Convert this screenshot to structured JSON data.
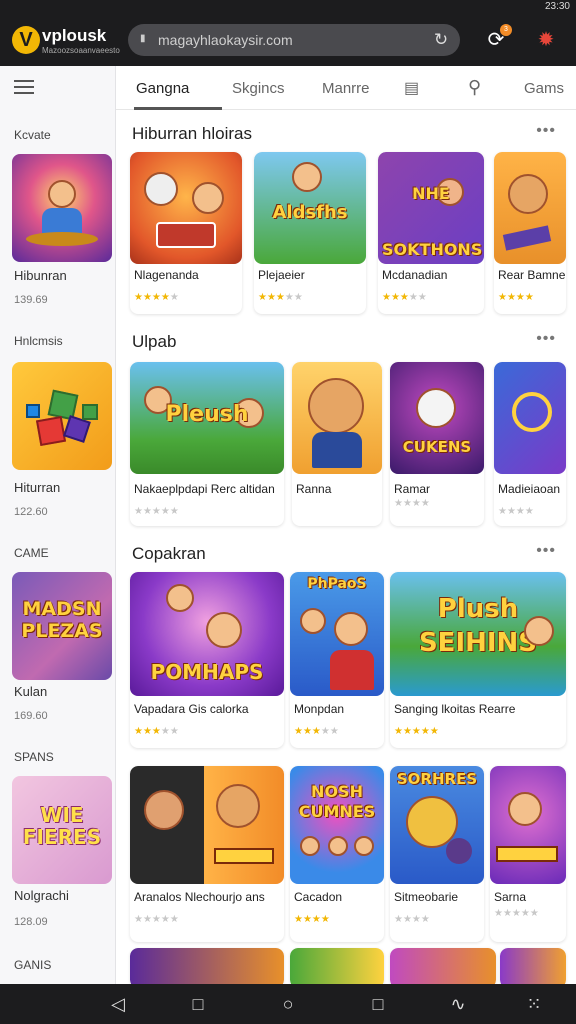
{
  "status": {
    "time": "23:30"
  },
  "header": {
    "logo_name": "vplousk",
    "logo_sub": "Mazoozsoaanvaeesto",
    "url": "magayhlaokaysir.com",
    "icons": [
      "lock-icon",
      "reload-icon",
      "notification-icon",
      "settings-icon"
    ],
    "notification_count": "3"
  },
  "tabs": [
    {
      "label": "Gangna",
      "active": true
    },
    {
      "label": "Skgincs"
    },
    {
      "label": "Manrre"
    },
    {
      "label": ""
    },
    {
      "label": ""
    },
    {
      "label": "Gams"
    }
  ],
  "sidebar": {
    "sections": [
      {
        "header": "Kcvate",
        "title": "Hibunran",
        "meta": "139.69",
        "thumb_word": ""
      },
      {
        "header": "Hnlcmsis",
        "title": "Hiturran",
        "meta": "122.60",
        "thumb_word": ""
      },
      {
        "header": "CAME",
        "title": "Kulan",
        "meta": "169.60",
        "thumb_word": "MADSN PLEZAS"
      },
      {
        "header": "SPANS",
        "title": "Nolgrachi",
        "meta": "128.09",
        "thumb_word": "WIE FIERES"
      },
      {
        "header": "GANIS"
      }
    ]
  },
  "sections": [
    {
      "title": "Hiburran hloiras",
      "cards": [
        {
          "title": "Nlagenanda",
          "rating": 3.5,
          "art_word": ""
        },
        {
          "title": "Plejaeier",
          "rating": 3,
          "art_word": "Aldsfhs"
        },
        {
          "title": "Mcdanadian",
          "rating": 3,
          "art_word": "NHE SOKTHONS"
        },
        {
          "title": "Rear Bamne",
          "rating": 4,
          "art_word": ""
        }
      ]
    },
    {
      "title": "Ulpab",
      "cards": [
        {
          "title": "Nakaeplpdapi Rerc altidan",
          "rating": 0,
          "art_word": "Pleush"
        },
        {
          "title": "Ranna",
          "rating": 0,
          "art_word": ""
        },
        {
          "title": "Ramar",
          "rating": 0,
          "art_word": "CUKENS"
        },
        {
          "title": "Madieiaoan",
          "rating": 0,
          "art_word": ""
        }
      ]
    },
    {
      "title": "Copakran",
      "cards": [
        {
          "title": "Vapadara Gis calorka",
          "rating": 3,
          "art_word": "POMHAPS"
        },
        {
          "title": "Monpdan",
          "rating": 3,
          "art_word": "PhPaoS"
        },
        {
          "title": "Sanging lkoitas Rearre",
          "rating": 5,
          "art_word": "Plush SEIHINS"
        }
      ]
    },
    {
      "title": "",
      "cards": [
        {
          "title": "Aranalos Nlechourjo ans",
          "rating": 0,
          "art_word": ""
        },
        {
          "title": "Cacadon",
          "rating": 4,
          "art_word": "NOSH CUMNES"
        },
        {
          "title": "Sitmeobarie",
          "rating": 0,
          "art_word": "SORHRES"
        },
        {
          "title": "Sarna",
          "rating": 0,
          "art_word": ""
        }
      ]
    }
  ],
  "bottom_nav": [
    "back-icon",
    "square-icon",
    "home-icon",
    "recents-icon",
    "gesture-icon",
    "grid-icon"
  ]
}
